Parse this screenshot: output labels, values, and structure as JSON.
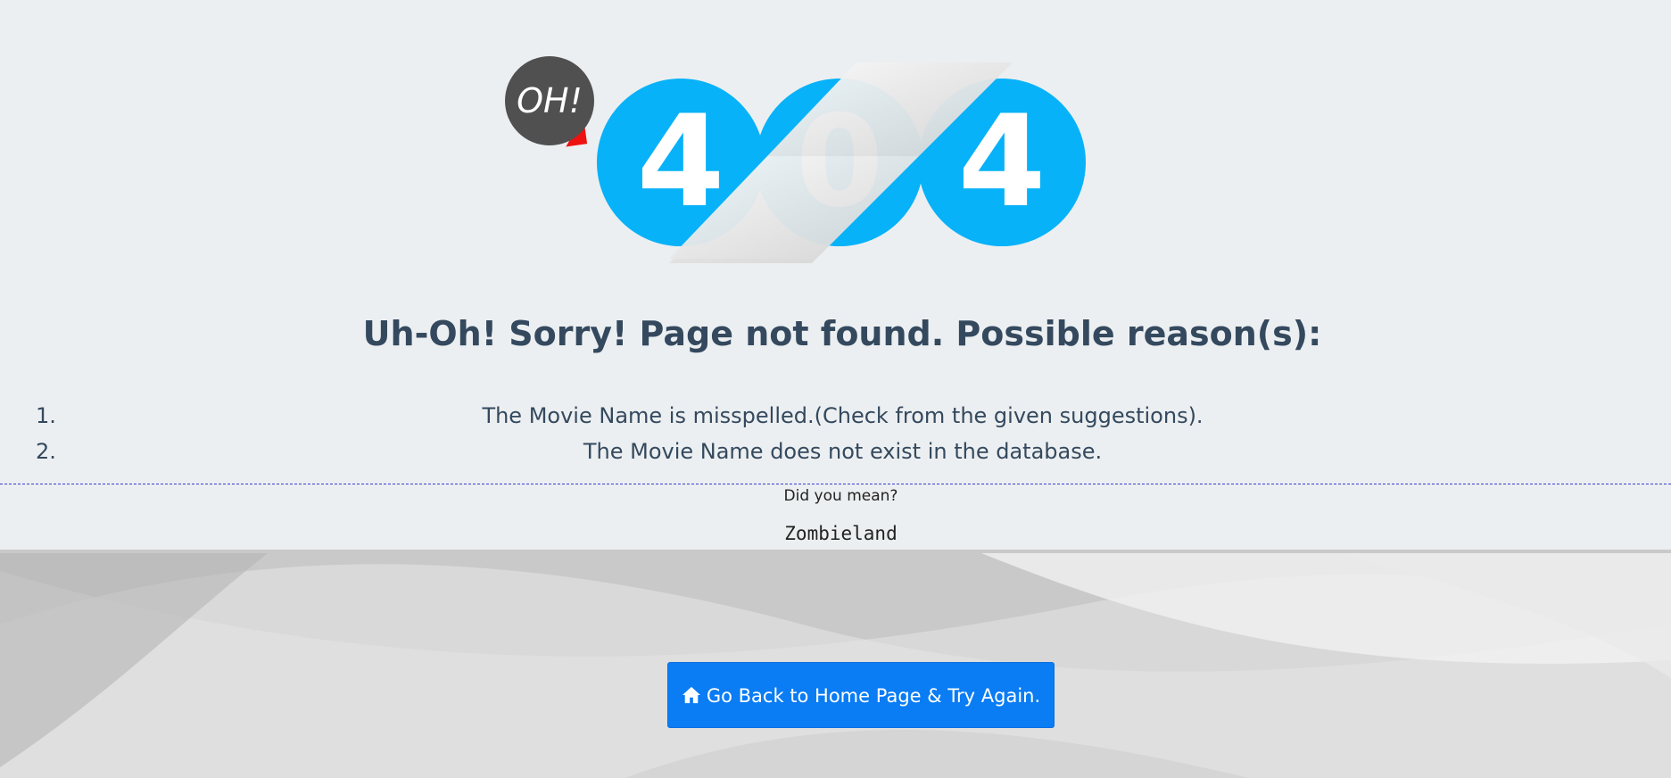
{
  "hero": {
    "oh_text": "OH!",
    "digits": [
      "4",
      "0",
      "4"
    ],
    "circle_color": "#08b2f8",
    "bubble_color": "#505050",
    "tail_color": "#ee1111"
  },
  "heading": "Uh-Oh! Sorry! Page not found. Possible reason(s):",
  "reasons": [
    {
      "num": "1.",
      "text": "The Movie Name is misspelled.(Check from the given suggestions)."
    },
    {
      "num": "2.",
      "text": "The Movie Name does not exist in the database."
    }
  ],
  "suggestions": {
    "label": "Did you mean?",
    "items": [
      "Zombieland"
    ]
  },
  "home_button": {
    "icon": "home-icon",
    "label": "Go Back to Home Page & Try Again.",
    "color": "#0a7cf4"
  }
}
